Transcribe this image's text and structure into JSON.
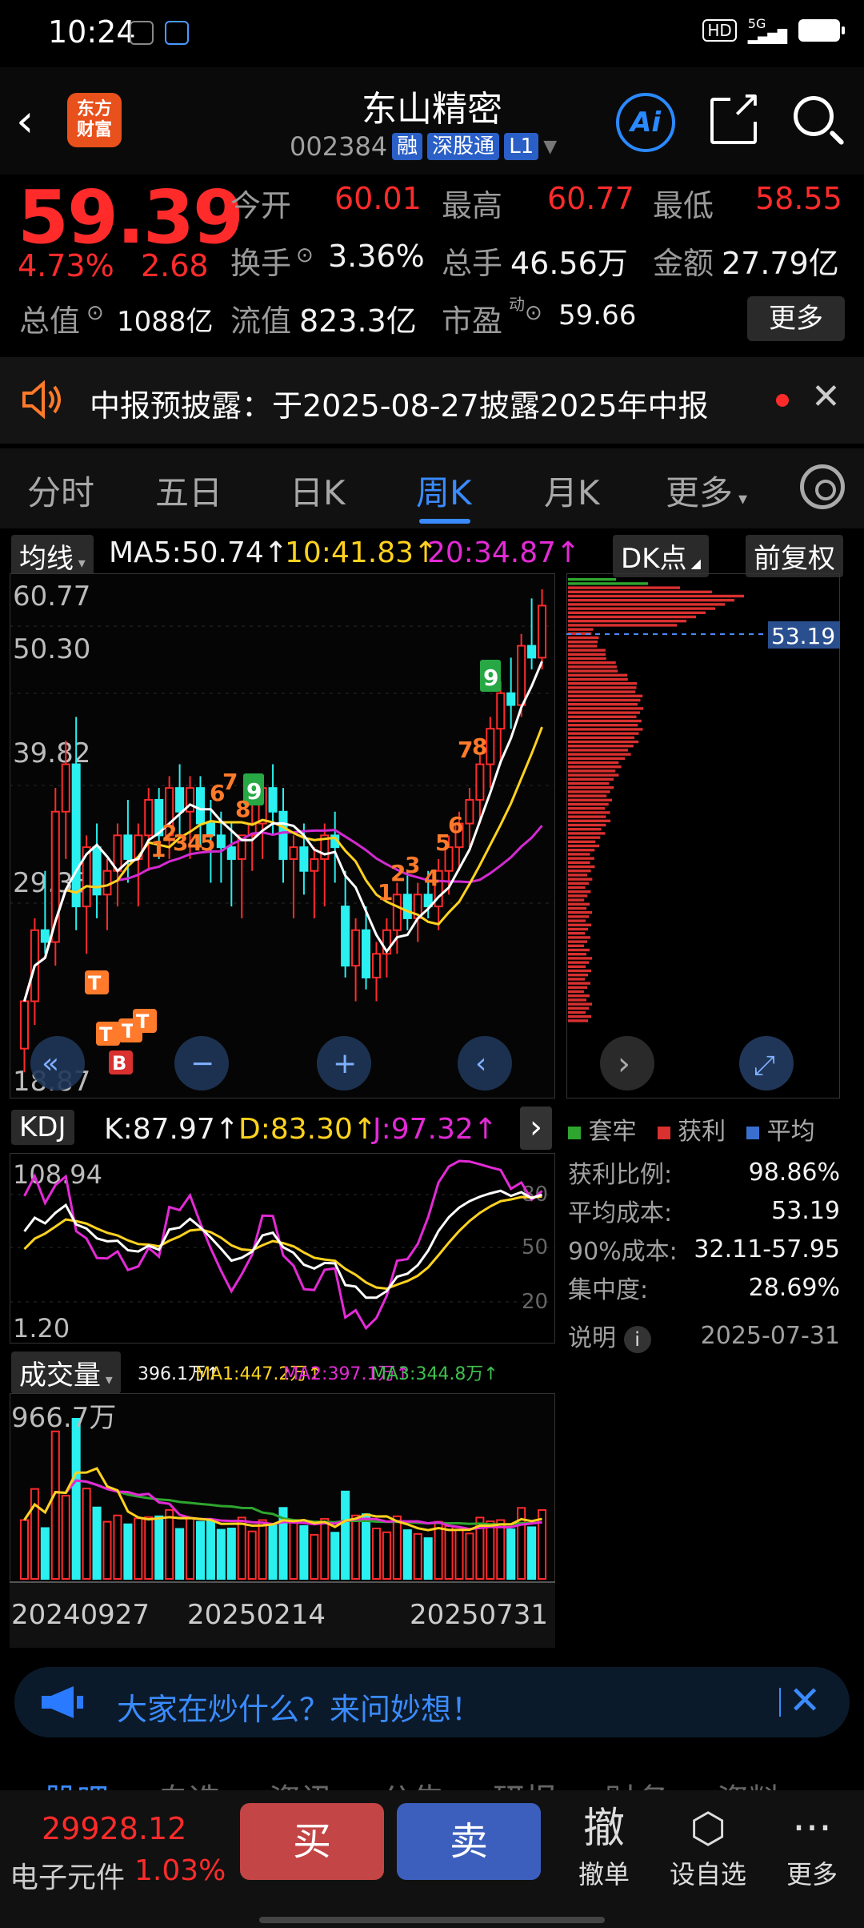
{
  "status_bar": {
    "time": "10:24",
    "network": "5G",
    "hd": "HD"
  },
  "header": {
    "stock_name": "东山精密",
    "stock_code": "002384",
    "tags": [
      "融",
      "深股通",
      "L1"
    ],
    "logo_text": "东方\n财富",
    "ai_label": "Ai"
  },
  "quote": {
    "price": "59.39",
    "change_pct": "4.73%",
    "change": "2.68",
    "fields": [
      {
        "label": "今开",
        "value": "60.01",
        "color": "#ff2b2b"
      },
      {
        "label": "最高",
        "value": "60.77",
        "color": "#ff2b2b"
      },
      {
        "label": "最低",
        "value": "58.55",
        "color": "#ff2b2b"
      },
      {
        "label": "换手",
        "value": "3.36%",
        "color": "#f2f2f2"
      },
      {
        "label": "总手",
        "value": "46.56万",
        "color": "#f2f2f2"
      },
      {
        "label": "金额",
        "value": "27.79亿",
        "color": "#f2f2f2"
      },
      {
        "label": "总值",
        "value": "1088亿",
        "color": "#f2f2f2"
      },
      {
        "label": "流值",
        "value": "823.3亿",
        "color": "#f2f2f2"
      },
      {
        "label": "市盈",
        "value": "59.66",
        "color": "#f2f2f2",
        "superscript": "动"
      }
    ],
    "more_label": "更多"
  },
  "notice": {
    "text": "中报预披露：于2025-08-27披露2025年中报"
  },
  "tabs": {
    "items": [
      "分时",
      "五日",
      "日K",
      "周K",
      "月K",
      "更多"
    ],
    "active": "周K"
  },
  "ma_bar": {
    "selector": "均线",
    "ma5": "MA5:50.74↑",
    "ma10": "10:41.83↑",
    "ma20": "20:34.87↑",
    "dk_label": "DK点",
    "adjust_label": "前复权"
  },
  "main_chart": {
    "price_levels": [
      "60.77",
      "50.30",
      "39.82",
      "29.35",
      "18.87"
    ],
    "cost_marker": "53.19"
  },
  "kdj_bar": {
    "label": "KDJ",
    "k": "K:87.97↑",
    "d": "D:83.30↑",
    "j": "J:97.32↑"
  },
  "kdj_chart": {
    "levels": [
      "108.94",
      "80",
      "50",
      "20",
      "1.20"
    ]
  },
  "volume_bar": {
    "label": "成交量",
    "vol": "396.1万↑",
    "ma1": "MA1:447.2万↑",
    "ma2": "MA2:397.1万↑",
    "ma3": "MA3:344.8万↑"
  },
  "volume_chart": {
    "max_label": "966.7万",
    "dates": [
      "20240927",
      "20250214",
      "20250731"
    ]
  },
  "profile_legend": {
    "items": [
      "套牢",
      "获利",
      "平均"
    ]
  },
  "profile_stats": {
    "rows": [
      {
        "label": "获利比例:",
        "value": "98.86%"
      },
      {
        "label": "平均成本:",
        "value": "53.19"
      },
      {
        "label": "90%成本:",
        "value": "32.11-57.95"
      },
      {
        "label": "集中度:",
        "value": "28.69%"
      }
    ],
    "note_label": "说明",
    "note_date": "2025-07-31"
  },
  "ask_bar": {
    "text": "大家在炒什么？来问妙想！"
  },
  "bottom_bar": {
    "index_value": "29928.12",
    "index_name": "电子元件",
    "index_pct": "1.03%",
    "buy": "买",
    "sell": "卖",
    "actions": [
      {
        "icon": "撤",
        "label": "撤单"
      },
      {
        "icon": "⬡",
        "label": "设自选"
      },
      {
        "icon": "···",
        "label": "更多"
      }
    ]
  },
  "chart_data": {
    "type": "candlestick",
    "title": "",
    "y_range": [
      18.87,
      60.77
    ],
    "candles": [
      [
        22,
        26,
        20,
        26
      ],
      [
        26,
        33,
        24,
        32
      ],
      [
        32,
        37,
        30,
        31
      ],
      [
        31,
        44,
        29,
        42
      ],
      [
        42,
        48,
        38,
        46
      ],
      [
        46,
        50,
        32,
        34
      ],
      [
        34,
        40,
        30,
        39
      ],
      [
        39,
        41,
        33,
        35
      ],
      [
        35,
        38,
        32,
        37
      ],
      [
        37,
        41,
        34,
        40
      ],
      [
        40,
        43,
        36,
        38
      ],
      [
        38,
        41,
        34,
        40
      ],
      [
        40,
        44,
        37,
        43
      ],
      [
        43,
        44,
        38,
        40
      ],
      [
        40,
        45,
        38,
        44
      ],
      [
        44,
        46,
        40,
        42
      ],
      [
        42,
        45,
        38,
        44
      ],
      [
        44,
        45,
        39,
        41
      ],
      [
        41,
        43,
        36,
        40
      ],
      [
        40,
        42,
        36,
        39
      ],
      [
        39,
        41,
        34,
        38
      ],
      [
        38,
        40,
        33,
        40
      ],
      [
        40,
        43,
        37,
        41
      ],
      [
        41,
        45,
        38,
        44
      ],
      [
        44,
        46,
        40,
        42
      ],
      [
        42,
        44,
        36,
        38
      ],
      [
        38,
        40,
        33,
        39
      ],
      [
        39,
        41,
        35,
        37
      ],
      [
        37,
        39,
        33,
        38
      ],
      [
        38,
        41,
        34,
        40
      ],
      [
        40,
        42,
        36,
        39
      ],
      [
        34,
        37,
        28,
        29
      ],
      [
        29,
        33,
        26,
        32
      ],
      [
        32,
        34,
        27,
        28
      ],
      [
        28,
        31,
        26,
        30
      ],
      [
        30,
        33,
        28,
        32
      ],
      [
        32,
        36,
        30,
        35
      ],
      [
        35,
        37,
        32,
        33
      ],
      [
        33,
        36,
        31,
        35
      ],
      [
        35,
        37,
        33,
        34
      ],
      [
        34,
        38,
        32,
        37
      ],
      [
        37,
        40,
        35,
        39
      ],
      [
        39,
        42,
        37,
        41
      ],
      [
        41,
        44,
        39,
        43
      ],
      [
        43,
        47,
        41,
        46
      ],
      [
        46,
        50,
        44,
        49
      ],
      [
        49,
        53,
        46,
        52
      ],
      [
        52,
        55,
        49,
        51
      ],
      [
        51,
        57,
        50,
        56
      ],
      [
        56,
        60,
        54,
        55
      ],
      [
        55,
        60.77,
        54,
        59.39
      ]
    ],
    "kdj": {
      "k": [
        87.97
      ],
      "d": [
        83.3
      ],
      "j": [
        97.32
      ]
    },
    "x_labels": [
      "20240927",
      "20250214",
      "20250731"
    ]
  }
}
